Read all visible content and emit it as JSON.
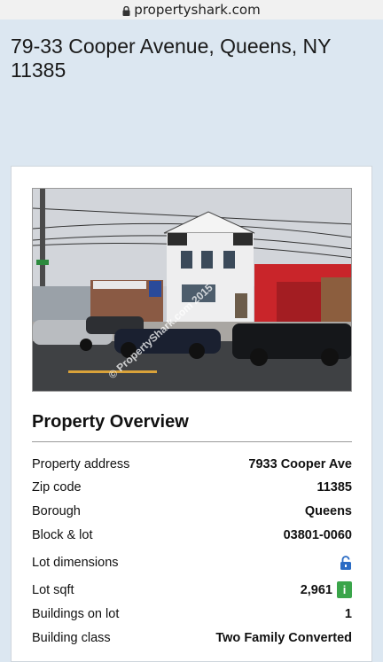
{
  "browser": {
    "url": "propertyshark.com"
  },
  "page": {
    "title": "79-33 Cooper Avenue, Queens, NY 11385"
  },
  "photo": {
    "watermark": "© PropertyShark.com 2015"
  },
  "overview": {
    "heading": "Property Overview",
    "rows": [
      {
        "label": "Property address",
        "value": "7933 Cooper Ave"
      },
      {
        "label": "Zip code",
        "value": "11385"
      },
      {
        "label": "Borough",
        "value": "Queens"
      },
      {
        "label": "Block & lot",
        "value": "03801-0060"
      },
      {
        "label": "Lot dimensions",
        "value": "",
        "icon": "unlock-icon"
      },
      {
        "label": "Lot sqft",
        "value": "2,961",
        "badge": "i"
      },
      {
        "label": "Buildings on lot",
        "value": "1"
      },
      {
        "label": "Building class",
        "value": "Two Family Converted"
      }
    ]
  },
  "colors": {
    "header_bg": "#dce7f1",
    "link_blue": "#2b6cc4",
    "info_green": "#3aa54a"
  }
}
